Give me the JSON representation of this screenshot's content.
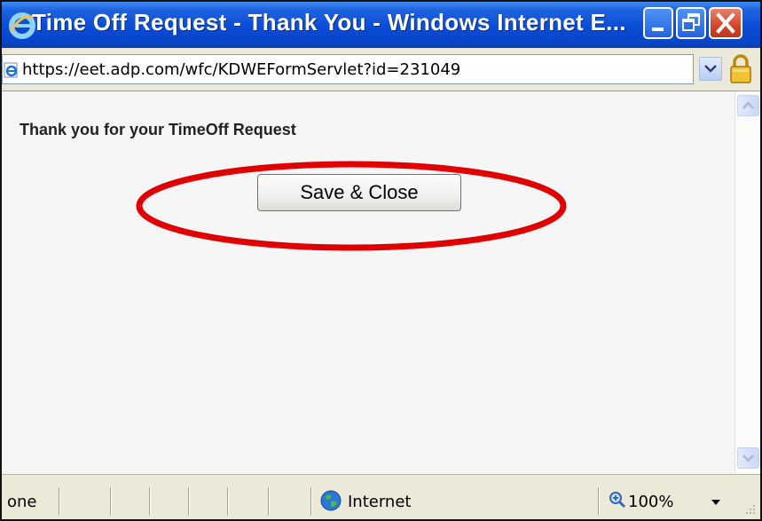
{
  "window": {
    "title": "Time Off Request - Thank You - Windows Internet E...",
    "icon": "ie-logo-icon"
  },
  "address_bar": {
    "url": "https://eet.adp.com/wfc/KDWEFormServlet?id=231049",
    "page_icon": "ie-page-icon",
    "security_icon": "lock-icon"
  },
  "content": {
    "message": "Thank you for your TimeOff Request",
    "save_close_label": "Save & Close",
    "highlight_color": "#e00000"
  },
  "status_bar": {
    "status": "one",
    "zone": "Internet",
    "zoom": "100%"
  },
  "colors": {
    "titlebar": "#0a4cd6",
    "close_button": "#d2462a",
    "chrome": "#ece9d8"
  }
}
